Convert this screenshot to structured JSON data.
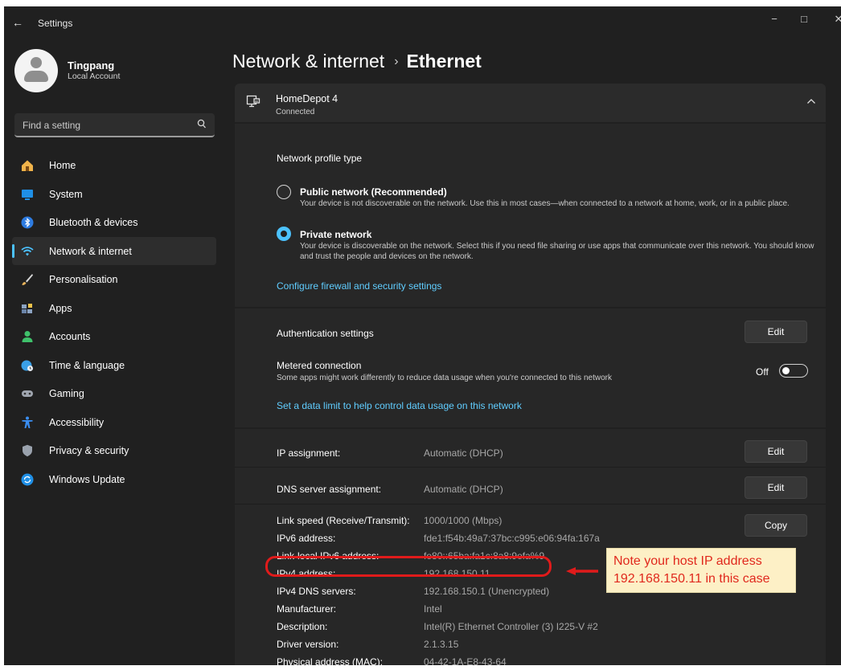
{
  "window": {
    "title": "Settings",
    "back_glyph": "←",
    "controls": {
      "minimize": "−",
      "maximize": "□",
      "close": "✕"
    }
  },
  "profile": {
    "name": "Tingpang",
    "account_type": "Local Account"
  },
  "search": {
    "placeholder": "Find a setting",
    "icon": "search-icon"
  },
  "nav": {
    "items": [
      {
        "label": "Home",
        "icon": "home-icon",
        "color": "#f0b34a"
      },
      {
        "label": "System",
        "icon": "system-icon",
        "color": "#1f8fe6"
      },
      {
        "label": "Bluetooth & devices",
        "icon": "bluetooth-icon",
        "color": "#2d7be0"
      },
      {
        "label": "Network & internet",
        "icon": "wifi-icon",
        "color": "#4cc2ff",
        "active": true
      },
      {
        "label": "Personalisation",
        "icon": "brush-icon",
        "color": "#e8b45c"
      },
      {
        "label": "Apps",
        "icon": "apps-icon",
        "color": "#8ca3c2"
      },
      {
        "label": "Accounts",
        "icon": "accounts-icon",
        "color": "#3fc16b"
      },
      {
        "label": "Time & language",
        "icon": "globe-clock-icon",
        "color": "#3aa0e8"
      },
      {
        "label": "Gaming",
        "icon": "gamepad-icon",
        "color": "#a0a6b0"
      },
      {
        "label": "Accessibility",
        "icon": "accessibility-icon",
        "color": "#3a8df0"
      },
      {
        "label": "Privacy & security",
        "icon": "shield-icon",
        "color": "#9aa2ad"
      },
      {
        "label": "Windows Update",
        "icon": "update-icon",
        "color": "#1f8fe6"
      }
    ]
  },
  "breadcrumb": {
    "parent": "Network & internet",
    "separator": "›",
    "current": "Ethernet"
  },
  "connection": {
    "name": "HomeDepot 4",
    "status": "Connected"
  },
  "profile_type": {
    "heading": "Network profile type",
    "options": [
      {
        "label": "Public network (Recommended)",
        "description": "Your device is not discoverable on the network. Use this in most cases—when connected to a network at home, work, or in a public place.",
        "selected": false
      },
      {
        "label": "Private network",
        "description": "Your device is discoverable on the network. Select this if you need file sharing or use apps that communicate over this network. You should know and trust the people and devices on the network.",
        "selected": true
      }
    ],
    "firewall_link": "Configure firewall and security settings"
  },
  "authentication": {
    "label": "Authentication settings",
    "button": "Edit"
  },
  "metered": {
    "label": "Metered connection",
    "description": "Some apps might work differently to reduce data usage when you're connected to this network",
    "state_label": "Off",
    "on": false,
    "link": "Set a data limit to help control data usage on this network"
  },
  "ip_assignment": {
    "label": "IP assignment:",
    "value": "Automatic (DHCP)",
    "button": "Edit"
  },
  "dns_assignment": {
    "label": "DNS server assignment:",
    "value": "Automatic (DHCP)",
    "button": "Edit"
  },
  "details": {
    "copy_button": "Copy",
    "rows": [
      {
        "label": "Link speed (Receive/Transmit):",
        "value": "1000/1000 (Mbps)"
      },
      {
        "label": "IPv6 address:",
        "value": "fde1:f54b:49a7:37bc:c995:e06:94fa:167a"
      },
      {
        "label": "Link-local IPv6 address:",
        "value": "fe80::65ba:fa1c:8a8:9efa%9"
      },
      {
        "label": "IPv4 address:",
        "value": "192.168.150.11"
      },
      {
        "label": "IPv4 DNS servers:",
        "value": "192.168.150.1 (Unencrypted)"
      },
      {
        "label": "Manufacturer:",
        "value": "Intel"
      },
      {
        "label": "Description:",
        "value": "Intel(R) Ethernet Controller (3) I225-V #2"
      },
      {
        "label": "Driver version:",
        "value": "2.1.3.15"
      },
      {
        "label": "Physical address (MAC):",
        "value": "04-42-1A-E8-43-64"
      }
    ]
  },
  "annotation": {
    "line1": "Note your host IP address",
    "line2": "192.168.150.11 in this case",
    "color": "#e0281d",
    "background": "#fdf0c6"
  }
}
